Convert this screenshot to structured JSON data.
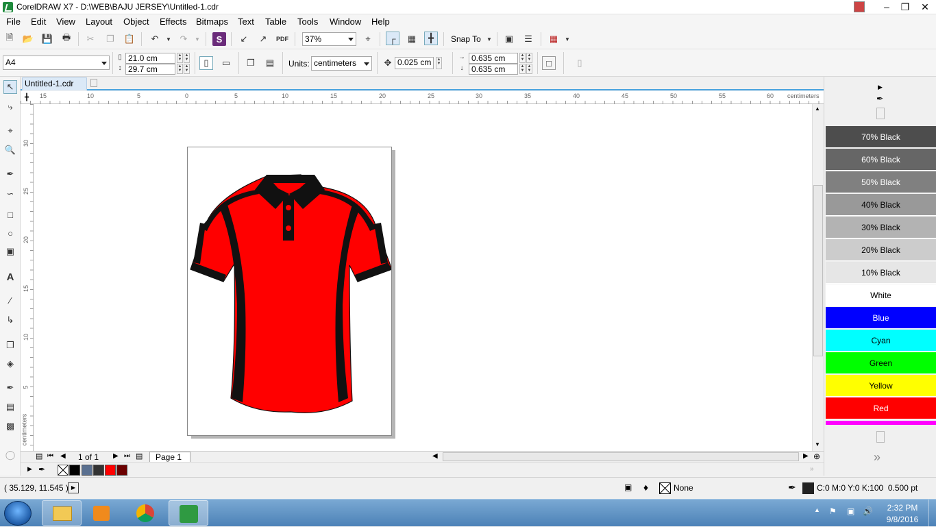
{
  "window": {
    "title": "CorelDRAW X7 - D:\\WEB\\BAJU JERSEY\\Untitled-1.cdr"
  },
  "menu": [
    "File",
    "Edit",
    "View",
    "Layout",
    "Object",
    "Effects",
    "Bitmaps",
    "Text",
    "Table",
    "Tools",
    "Window",
    "Help"
  ],
  "toolbar": {
    "zoom": "37%",
    "snap_to": "Snap To"
  },
  "propbar": {
    "paper_size": "A4",
    "width": "21.0 cm",
    "height": "29.7 cm",
    "units_label": "Units:",
    "units_value": "centimeters",
    "nudge": "0.025 cm",
    "dup_x": "0.635 cm",
    "dup_y": "0.635 cm"
  },
  "doc_tab": "Untitled-1.cdr",
  "ruler": {
    "unit": "centimeters",
    "h_ticks": [
      "15",
      "10",
      "5",
      "0",
      "5",
      "10",
      "15",
      "20",
      "25",
      "30",
      "35",
      "40",
      "45",
      "50",
      "55",
      "60"
    ],
    "v_ticks": [
      "30",
      "25",
      "20",
      "15",
      "10",
      "5"
    ]
  },
  "pager": {
    "count": "1 of 1",
    "page_tab": "Page 1"
  },
  "palette": [
    {
      "label": "70% Black",
      "color": "#4d4d4d",
      "text": "#ffffff"
    },
    {
      "label": "60% Black",
      "color": "#666666",
      "text": "#ffffff"
    },
    {
      "label": "50% Black",
      "color": "#808080",
      "text": "#ffffff"
    },
    {
      "label": "40% Black",
      "color": "#999999",
      "text": "#000000"
    },
    {
      "label": "30% Black",
      "color": "#b3b3b3",
      "text": "#000000"
    },
    {
      "label": "20% Black",
      "color": "#cccccc",
      "text": "#000000"
    },
    {
      "label": "10% Black",
      "color": "#e6e6e6",
      "text": "#000000"
    },
    {
      "label": "White",
      "color": "#ffffff",
      "text": "#000000"
    },
    {
      "label": "Blue",
      "color": "#0000ff",
      "text": "#ffffff"
    },
    {
      "label": "Cyan",
      "color": "#00ffff",
      "text": "#000000"
    },
    {
      "label": "Green",
      "color": "#00ff00",
      "text": "#000000"
    },
    {
      "label": "Yellow",
      "color": "#ffff00",
      "text": "#000000"
    },
    {
      "label": "Red",
      "color": "#ff0000",
      "text": "#ffffff"
    }
  ],
  "doc_palette_colors": [
    "#000000",
    "#5a7090",
    "#333333",
    "#ff0000",
    "#6b0000"
  ],
  "status": {
    "coords": "( 35.129, 11.545 )",
    "fill_label": "None",
    "outline_info": "C:0 M:0 Y:0 K:100  0.500 pt"
  },
  "taskbar": {
    "time": "2:32 PM",
    "date": "9/8/2016"
  },
  "jersey": {
    "body_color": "#ff0000",
    "trim_color": "#111111"
  }
}
